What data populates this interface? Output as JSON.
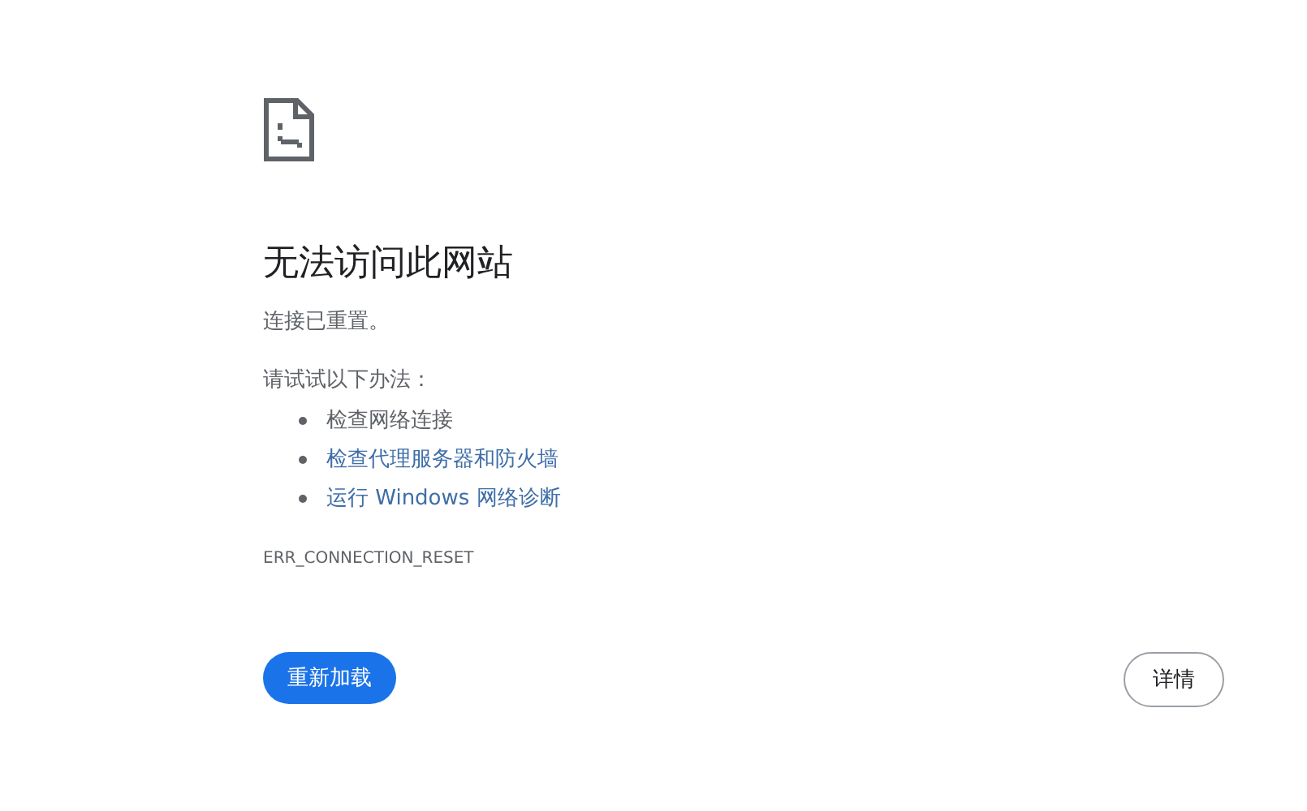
{
  "title": "无法访问此网站",
  "message": "连接已重置。",
  "suggestions_heading": "请试试以下办法：",
  "suggestions": [
    {
      "text": "检查网络连接",
      "kind": "text"
    },
    {
      "text": "检查代理服务器和防火墙",
      "kind": "link"
    },
    {
      "text": "运行 Windows 网络诊断",
      "kind": "link"
    }
  ],
  "error_code": "ERR_CONNECTION_RESET",
  "buttons": {
    "reload": "重新加载",
    "details": "详情"
  }
}
